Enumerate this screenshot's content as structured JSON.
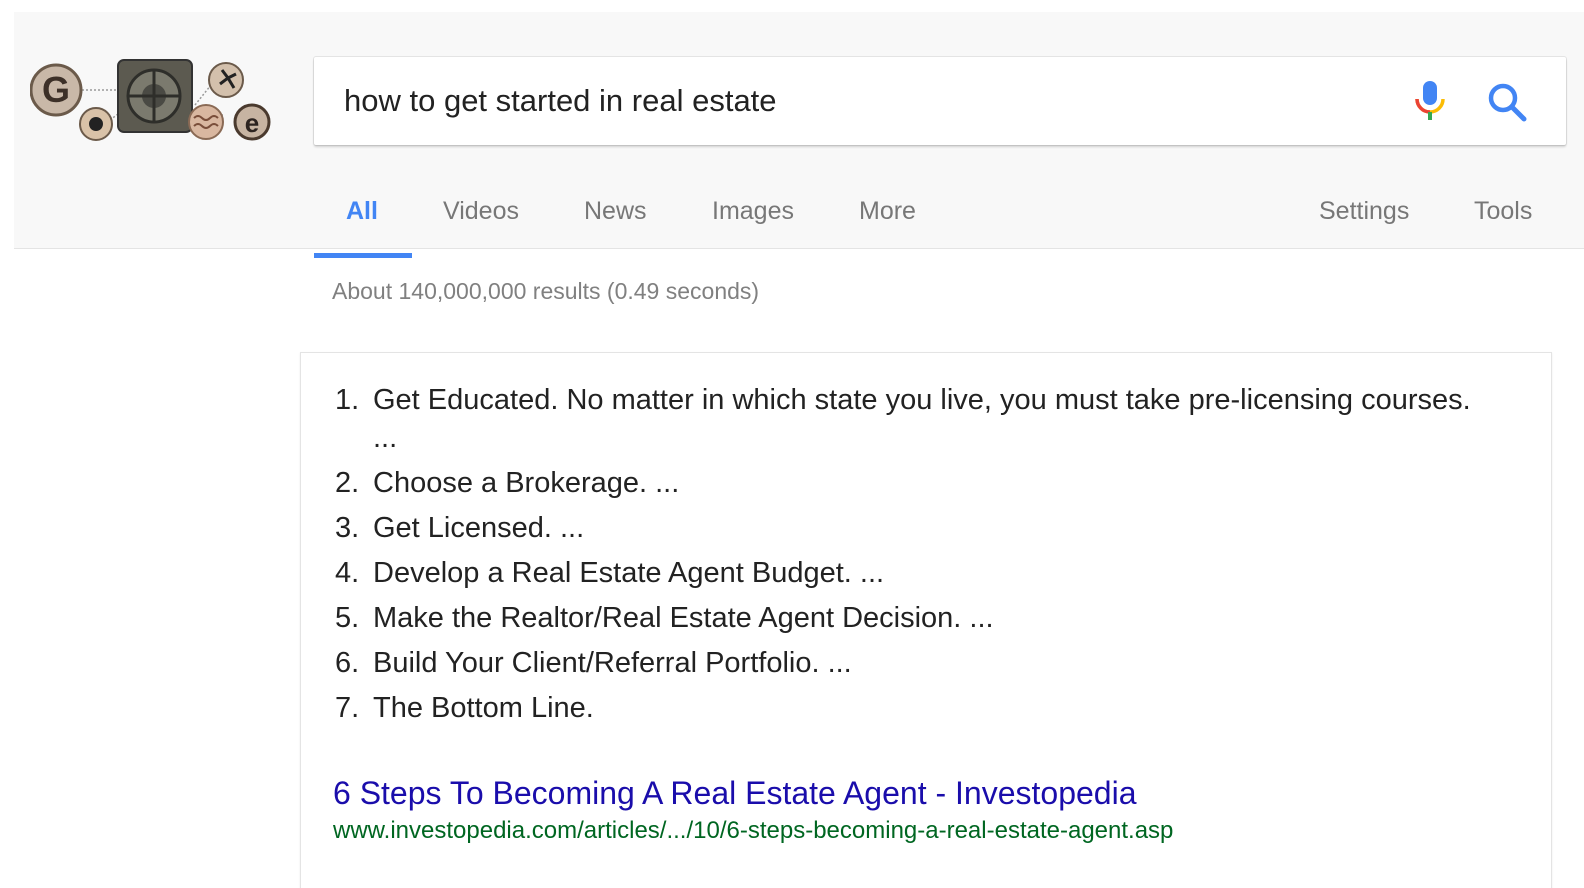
{
  "search": {
    "query": "how to get started in real estate"
  },
  "tabs": [
    {
      "label": "All",
      "active": true
    },
    {
      "label": "Videos"
    },
    {
      "label": "News"
    },
    {
      "label": "Images"
    },
    {
      "label": "More"
    },
    {
      "label": "Settings"
    },
    {
      "label": "Tools"
    }
  ],
  "stats": "About 140,000,000 results (0.49 seconds)",
  "snippet": {
    "items": [
      {
        "num": "1.",
        "text": "Get Educated. No matter in which state you live, you must take pre-licensing courses. ..."
      },
      {
        "num": "2.",
        "text": "Choose a Brokerage. ..."
      },
      {
        "num": "3.",
        "text": "Get Licensed. ..."
      },
      {
        "num": "4.",
        "text": "Develop a Real Estate Agent Budget. ..."
      },
      {
        "num": "5.",
        "text": "Make the Realtor/Real Estate Agent Decision. ..."
      },
      {
        "num": "6.",
        "text": "Build Your Client/Referral Portfolio. ..."
      },
      {
        "num": "7.",
        "text": "The Bottom Line."
      }
    ],
    "title": "6 Steps To Becoming A Real Estate Agent - Investopedia",
    "url": "www.investopedia.com/articles/.../10/6-steps-becoming-a-real-estate-agent.asp"
  },
  "colors": {
    "accent": "#4285f4",
    "link": "#1a0dab",
    "url": "#006621"
  },
  "icons": {
    "logo": "google-doodle-logo",
    "mic": "microphone-icon",
    "search": "search-icon"
  }
}
